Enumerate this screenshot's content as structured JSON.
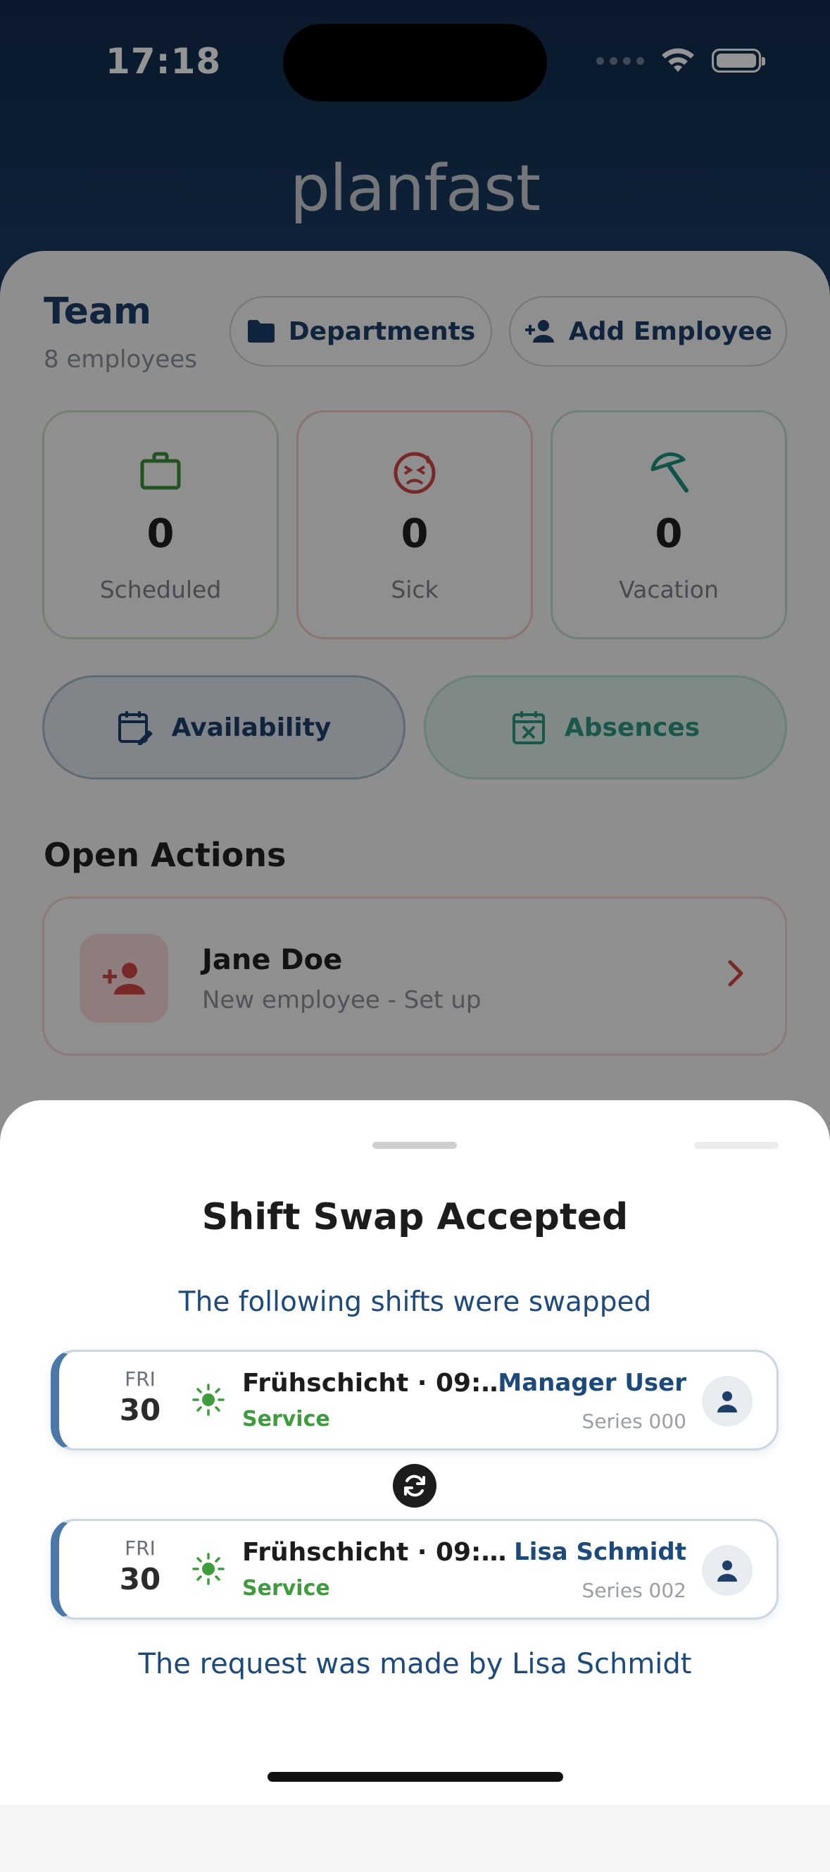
{
  "status_bar": {
    "time": "17:18"
  },
  "app": {
    "logo_text": "planfast"
  },
  "team": {
    "title": "Team",
    "subtitle": "8 employees",
    "departments_label": "Departments",
    "add_employee_label": "Add Employee"
  },
  "stats": [
    {
      "value": "0",
      "label": "Scheduled",
      "color": "#3a8f3a"
    },
    {
      "value": "0",
      "label": "Sick",
      "color": "#d04545"
    },
    {
      "value": "0",
      "label": "Vacation",
      "color": "#1f8f7f"
    }
  ],
  "buttons": {
    "availability_label": "Availability",
    "absences_label": "Absences"
  },
  "open_actions": {
    "title": "Open Actions",
    "items": [
      {
        "name": "Jane Doe",
        "subtitle": "New employee - Set up"
      }
    ]
  },
  "sheet": {
    "title": "Shift Swap Accepted",
    "subtitle": "The following shifts were swapped",
    "shifts": [
      {
        "weekday": "FRI",
        "day": "30",
        "title": "Frühschicht · 09:00...",
        "department": "Service",
        "person": "Manager User",
        "series": "Series 000"
      },
      {
        "weekday": "FRI",
        "day": "30",
        "title": "Frühschicht · 09:00 ...",
        "department": "Service",
        "person": "Lisa Schmidt",
        "series": "Series 002"
      }
    ],
    "request_note": "The request was made by Lisa Schmidt"
  },
  "colors": {
    "primary": "#1d3f6a",
    "accent_green": "#3e9c3e",
    "accent_teal": "#2f9482",
    "accent_red": "#d04545"
  },
  "icons": [
    "wifi-icon",
    "battery-icon",
    "folder-icon",
    "person-add-icon",
    "briefcase-icon",
    "sick-face-icon",
    "umbrella-icon",
    "calendar-edit-icon",
    "calendar-x-icon",
    "chevron-right-icon",
    "sun-icon",
    "person-icon",
    "swap-icon"
  ]
}
